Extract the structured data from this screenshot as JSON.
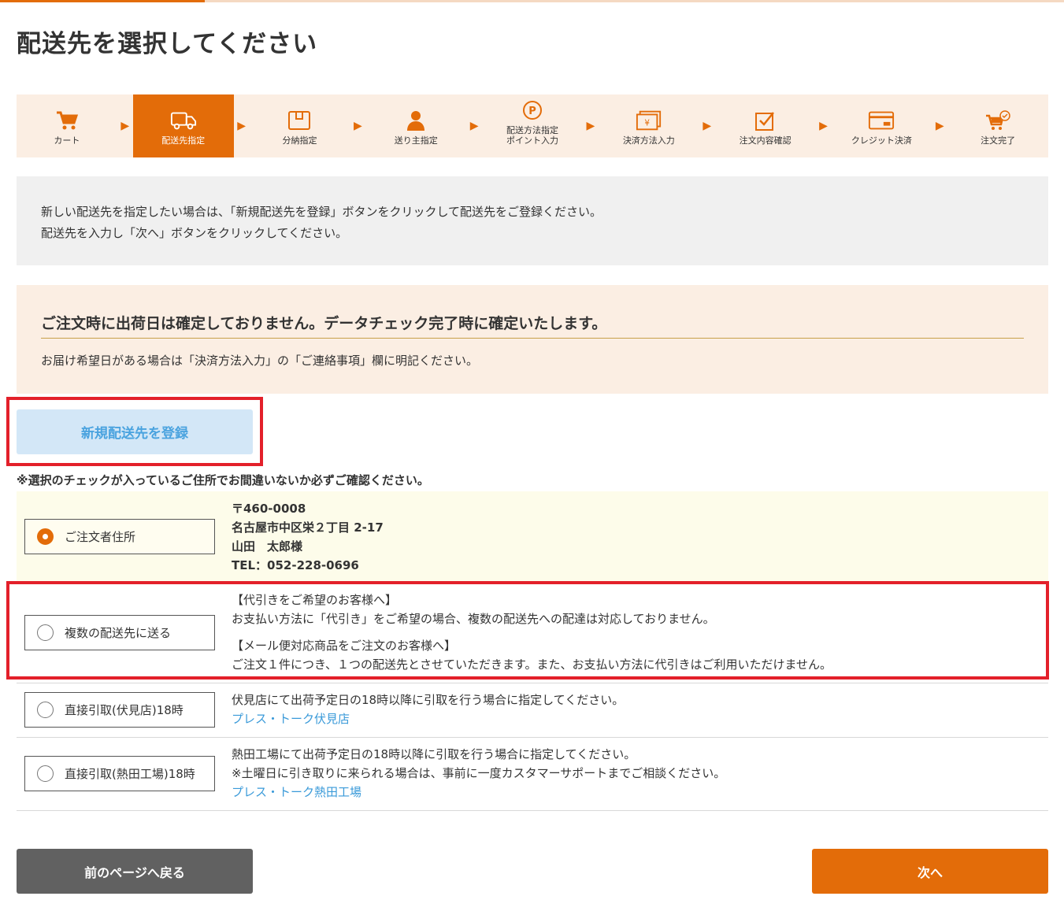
{
  "page": {
    "title": "配送先を選択してください"
  },
  "steps": [
    {
      "label": "カート",
      "icon": "cart-icon"
    },
    {
      "label": "配送先指定",
      "icon": "truck-icon",
      "active": true
    },
    {
      "label": "分納指定",
      "icon": "box-icon"
    },
    {
      "label": "送り主指定",
      "icon": "person-icon"
    },
    {
      "label": "配送方法指定\nポイント入力",
      "icon": "point-icon"
    },
    {
      "label": "決済方法入力",
      "icon": "yen-icon"
    },
    {
      "label": "注文内容確認",
      "icon": "checkbox-icon"
    },
    {
      "label": "クレジット決済",
      "icon": "card-icon"
    },
    {
      "label": "注文完了",
      "icon": "cart-complete-icon"
    }
  ],
  "info": {
    "line1": "新しい配送先を指定したい場合は、「新規配送先を登録」ボタンをクリックして配送先をご登録ください。",
    "line2": "配送先を入力し「次へ」ボタンをクリックしてください。"
  },
  "notice": {
    "title": "ご注文時に出荷日は確定しておりません。データチェック完了時に確定いたします。",
    "sub": "お届け希望日がある場合は「決済方法入力」の「ご連絡事項」欄に明記ください。"
  },
  "new_address_button": "新規配送先を登録",
  "check_note": "※選択のチェックが入っているご住所でお間違いないか必ずご確認ください。",
  "options": {
    "orderer": {
      "label": "ご注文者住所",
      "postal": "〒460-0008",
      "address": "名古屋市中区栄２丁目 2-17",
      "name": "山田　太郎様",
      "tel": "TEL：052-228-0696"
    },
    "multiple": {
      "label": "複数の配送先に送る",
      "h1": "【代引きをご希望のお客様へ】",
      "t1": "お支払い方法に「代引き」をご希望の場合、複数の配送先への配達は対応しておりません。",
      "h2": "【メール便対応商品をご注文のお客様へ】",
      "t2": "ご注文１件につき、１つの配送先とさせていただきます。また、お支払い方法に代引きはご利用いただけません。"
    },
    "pickup_fushimi": {
      "label": "直接引取(伏見店)18時",
      "t1": "伏見店にて出荷予定日の18時以降に引取を行う場合に指定してください。",
      "link": "プレス・トーク伏見店"
    },
    "pickup_atsuta": {
      "label": "直接引取(熱田工場)18時",
      "t1": "熱田工場にて出荷予定日の18時以降に引取を行う場合に指定してください。",
      "t2": "※土曜日に引き取りに来られる場合は、事前に一度カスタマーサポートまでご相談ください。",
      "link": "プレス・トーク熱田工場"
    }
  },
  "buttons": {
    "back": "前のページへ戻る",
    "next": "次へ"
  },
  "colors": {
    "accent": "#e36c09",
    "highlight": "#e3202a",
    "link": "#3a9ad9"
  }
}
